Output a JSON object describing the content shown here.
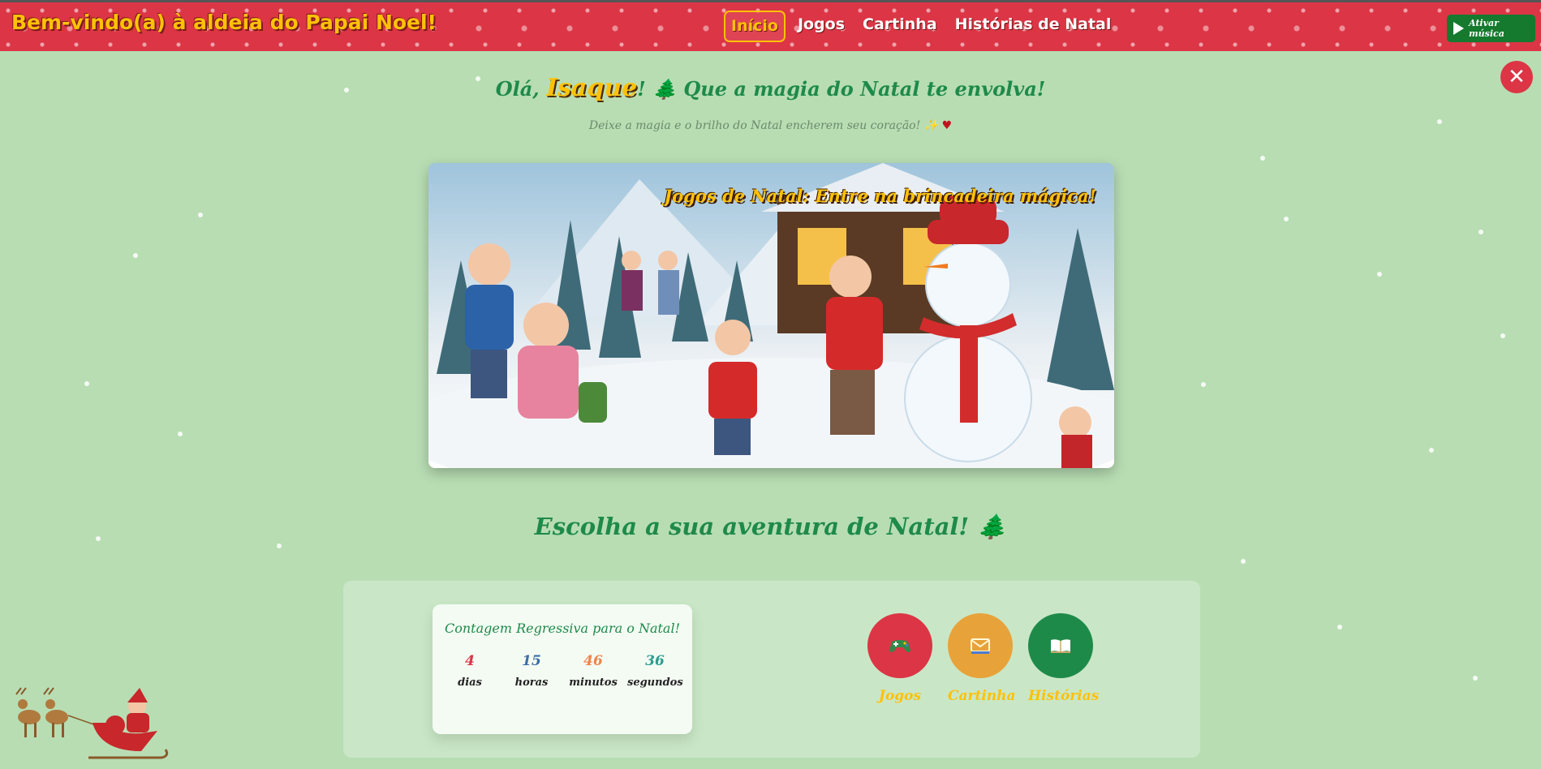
{
  "header": {
    "title": "Bem-vindo(a) à aldeia do Papai Noel!",
    "nav": [
      {
        "label": "Início",
        "active": true
      },
      {
        "label": "Jogos",
        "active": false
      },
      {
        "label": "Cartinha",
        "active": false
      },
      {
        "label": "Histórias de Natal",
        "active": false
      }
    ],
    "music_button": "Ativar música"
  },
  "close_label": "✕",
  "greeting": {
    "prefix": "Olá,",
    "name": "Isaque",
    "suffix": "! 🌲 Que a magia do Natal te envolva!",
    "sub": "Deixe a magia e o brilho do Natal encherem seu coração! ✨",
    "sub_heart": "♥"
  },
  "banner": {
    "caption": "Jogos de Natal: Entre na brincadeira mágica!"
  },
  "section_title": "Escolha a sua aventura de Natal! 🌲",
  "countdown": {
    "title": "Contagem Regressiva para o Natal!",
    "units": [
      {
        "value": "4",
        "label": "dias",
        "color": "#dc3545"
      },
      {
        "value": "15",
        "label": "horas",
        "color": "#3a6ea5"
      },
      {
        "value": "46",
        "label": "minutos",
        "color": "#f0834a"
      },
      {
        "value": "36",
        "label": "segundos",
        "color": "#2a9d8f"
      }
    ]
  },
  "actions": [
    {
      "label": "Jogos",
      "icon": "gamepad-icon",
      "color": "#dc3545"
    },
    {
      "label": "Cartinha",
      "icon": "envelope-icon",
      "color": "#e8a23a"
    },
    {
      "label": "Histórias",
      "icon": "book-icon",
      "color": "#1e8a4a"
    }
  ],
  "colors": {
    "background": "#b8ddb3",
    "header": "#dc3545",
    "accent": "#ffc107",
    "green": "#1e8a4a"
  }
}
